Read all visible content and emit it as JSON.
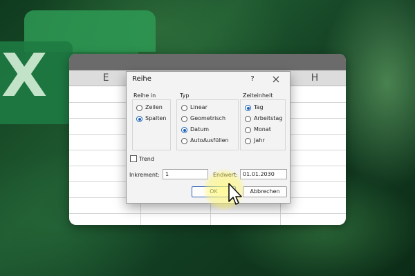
{
  "background": {
    "logo_letter": "X",
    "colors": {
      "dark_green": "#0f3a1e",
      "logo_green": "#1e7a42"
    }
  },
  "sheet": {
    "columns": [
      "E",
      "H"
    ]
  },
  "dialog": {
    "title": "Reihe",
    "help_label": "?",
    "close_icon": "close-icon",
    "groups": {
      "reihe_in": {
        "label": "Reihe in",
        "options": [
          {
            "label": "Zeilen",
            "selected": false
          },
          {
            "label": "Spalten",
            "selected": true
          }
        ]
      },
      "typ": {
        "label": "Typ",
        "options": [
          {
            "label": "Linear",
            "selected": false
          },
          {
            "label": "Geometrisch",
            "selected": false
          },
          {
            "label": "Datum",
            "selected": true
          },
          {
            "label": "AutoAusfüllen",
            "selected": false
          }
        ]
      },
      "zeiteinheit": {
        "label": "Zeiteinheit",
        "options": [
          {
            "label": "Tag",
            "selected": true
          },
          {
            "label": "Arbeitstag",
            "selected": false
          },
          {
            "label": "Monat",
            "selected": false
          },
          {
            "label": "Jahr",
            "selected": false
          }
        ]
      }
    },
    "trend": {
      "label": "Trend",
      "checked": false
    },
    "inkrement": {
      "label": "Inkrement:",
      "value": "1"
    },
    "endwert": {
      "label": "Endwert:",
      "value": "01.01.2030"
    },
    "ok_label": "OK",
    "cancel_label": "Abbrechen",
    "accent_color": "#1a5fb4"
  }
}
